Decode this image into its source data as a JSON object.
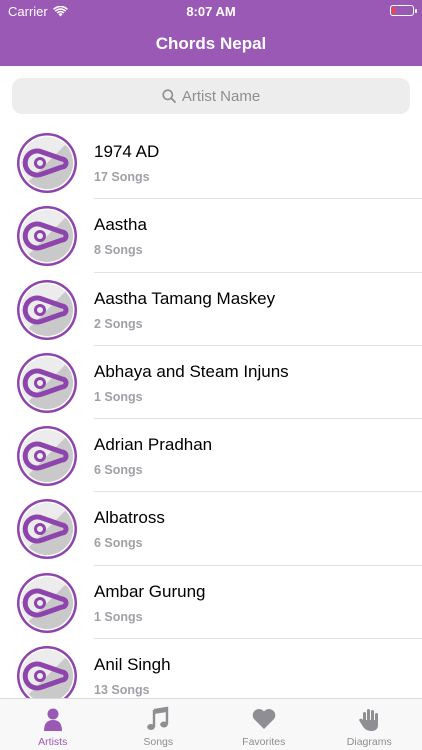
{
  "status_bar": {
    "carrier": "Carrier",
    "time": "8:07 AM",
    "battery_level": 0.15
  },
  "nav": {
    "title": "Chords Nepal"
  },
  "search": {
    "placeholder": "Artist Name"
  },
  "artists": [
    {
      "name": "1974 AD",
      "songs": "17 Songs"
    },
    {
      "name": "Aastha",
      "songs": "8 Songs"
    },
    {
      "name": "Aastha Tamang Maskey",
      "songs": "2 Songs"
    },
    {
      "name": "Abhaya and Steam Injuns",
      "songs": "1 Songs"
    },
    {
      "name": "Adrian Pradhan",
      "songs": "6 Songs"
    },
    {
      "name": "Albatross",
      "songs": "6 Songs"
    },
    {
      "name": "Ambar Gurung",
      "songs": "1 Songs"
    },
    {
      "name": "Anil Singh",
      "songs": "13 Songs"
    }
  ],
  "tabs": [
    {
      "label": "Artists",
      "icon": "person-icon",
      "active": true
    },
    {
      "label": "Songs",
      "icon": "music-note-icon",
      "active": false
    },
    {
      "label": "Favorites",
      "icon": "heart-icon",
      "active": false
    },
    {
      "label": "Diagrams",
      "icon": "hand-icon",
      "active": false
    }
  ],
  "colors": {
    "accent": "#9b59b6",
    "inactive": "#8e8e93"
  }
}
